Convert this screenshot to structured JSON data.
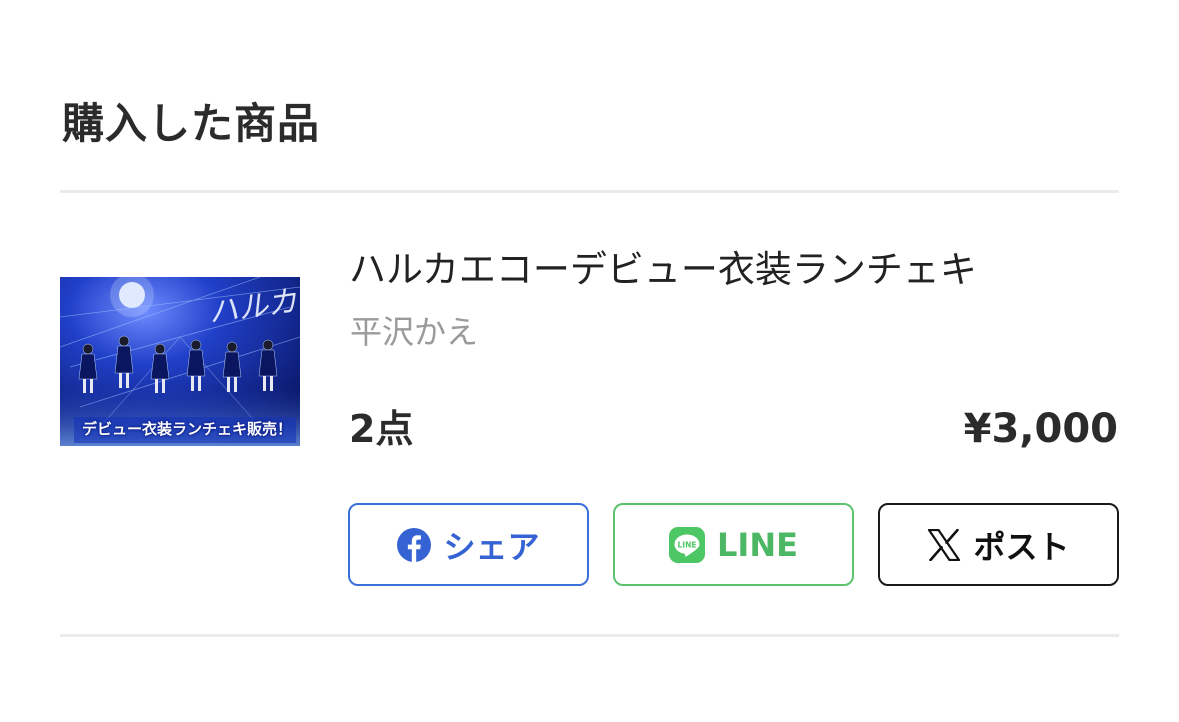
{
  "section": {
    "title": "購入した商品"
  },
  "product": {
    "image_caption": "デビュー衣装ランチェキ販売！",
    "name": "ハルカエコーデビュー衣装ランチェキ",
    "artist": "平沢かえ",
    "quantity": "2点",
    "price": "¥3,000"
  },
  "share": {
    "facebook": {
      "label": "シェア",
      "icon": "facebook-icon",
      "color": "#3b6fdc"
    },
    "line": {
      "label": "LINE",
      "icon": "line-icon",
      "color": "#5cc26f"
    },
    "x": {
      "label": "ポスト",
      "icon": "x-icon",
      "color": "#1a1a1a"
    }
  }
}
